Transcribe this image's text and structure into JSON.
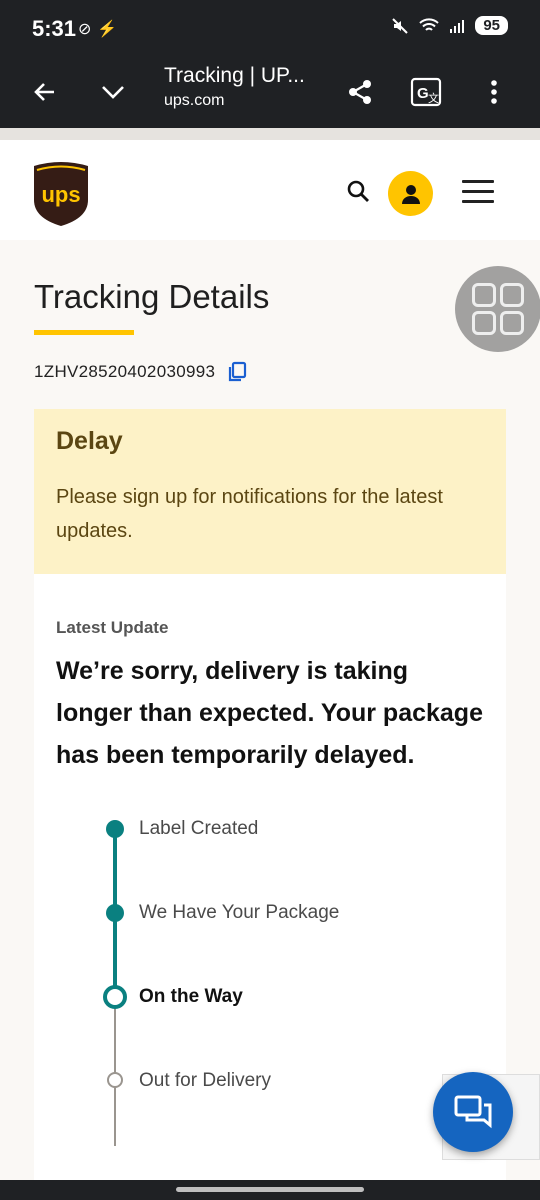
{
  "status_bar": {
    "time": "5:31",
    "battery": "95"
  },
  "browser": {
    "page_title": "Tracking | UP...",
    "url": "ups.com"
  },
  "colors": {
    "ups_brown": "#351c15",
    "ups_gold": "#ffc400",
    "delay_bg": "#fdf2c7",
    "timeline_teal": "#0a8080",
    "chat_blue": "#1565c0"
  },
  "header": {
    "logo_text": "ups"
  },
  "tracking": {
    "title": "Tracking Details",
    "number": "1ZHV28520402030993"
  },
  "alert": {
    "title": "Delay",
    "message": "Please sign up for notifications for the latest updates."
  },
  "latest": {
    "label": "Latest Update",
    "message": "We’re sorry, delivery is taking longer than expected. Your package has been temporarily delayed."
  },
  "timeline": {
    "steps": [
      {
        "label": "Label Created",
        "state": "completed"
      },
      {
        "label": "We Have Your Package",
        "state": "completed"
      },
      {
        "label": "On the Way",
        "state": "current"
      },
      {
        "label": "Out for Delivery",
        "state": "pending"
      }
    ]
  }
}
